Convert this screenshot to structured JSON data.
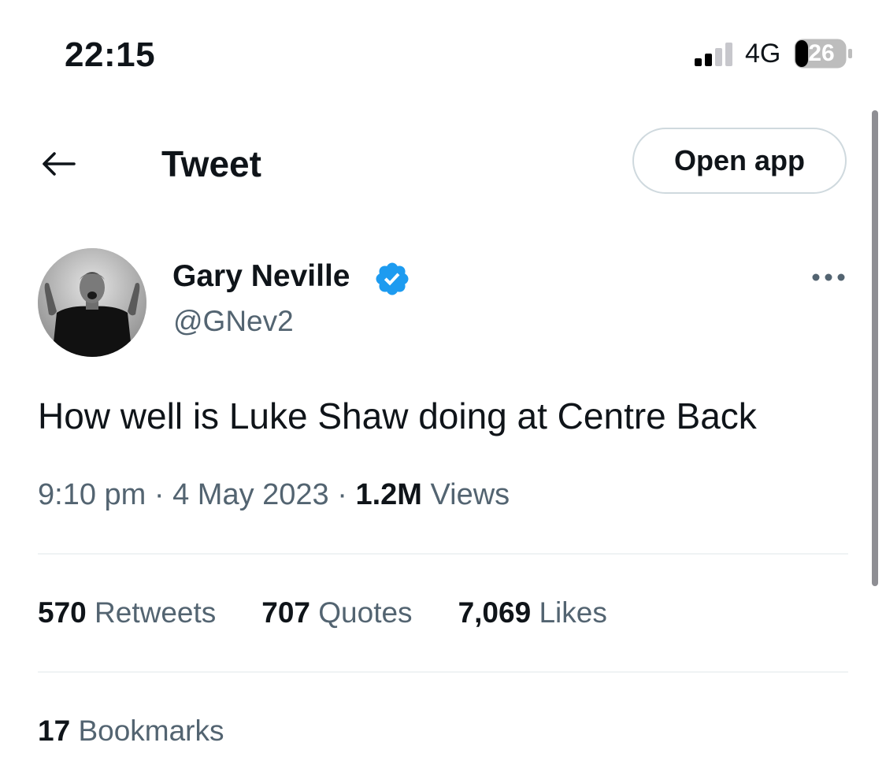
{
  "status_bar": {
    "time": "22:15",
    "network": "4G",
    "battery": "26"
  },
  "header": {
    "title": "Tweet",
    "open_app_label": "Open app"
  },
  "tweet": {
    "author_name": "Gary Neville",
    "author_handle": "@GNev2",
    "verified": true,
    "text": "How well is Luke Shaw doing at Centre Back",
    "time": "9:10 pm",
    "date": "4 May 2023",
    "views_count": "1.2M",
    "views_label": "Views",
    "separator": "·"
  },
  "stats": {
    "retweets_count": "570",
    "retweets_label": "Retweets",
    "quotes_count": "707",
    "quotes_label": "Quotes",
    "likes_count": "7,069",
    "likes_label": "Likes",
    "bookmarks_count": "17",
    "bookmarks_label": "Bookmarks"
  },
  "colors": {
    "text_primary": "#0f1419",
    "text_secondary": "#536471",
    "verified_blue": "#1d9bf0",
    "divider": "#eff3f4"
  },
  "icons": {
    "back": "arrow-left-icon",
    "verified": "verified-badge-icon",
    "more": "more-horizontal-icon",
    "signal": "cellular-signal-icon",
    "battery": "battery-icon"
  }
}
